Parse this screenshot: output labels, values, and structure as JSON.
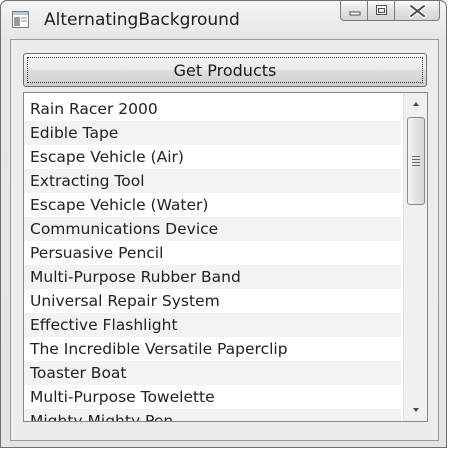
{
  "window": {
    "title": "AlternatingBackground",
    "icon": "window-app-icon",
    "caption_buttons": [
      "minimize-icon",
      "maximize-icon",
      "close-icon"
    ]
  },
  "toolbar": {
    "get_products_label": "Get Products"
  },
  "products": [
    "Rain Racer 2000",
    "Edible Tape",
    "Escape Vehicle (Air)",
    "Extracting Tool",
    "Escape Vehicle (Water)",
    "Communications Device",
    "Persuasive Pencil",
    "Multi-Purpose Rubber Band",
    "Universal Repair System",
    "Effective Flashlight",
    "The Incredible Versatile Paperclip",
    "Toaster Boat",
    "Multi-Purpose Towelette",
    "Mighty Mighty Pen"
  ],
  "colors": {
    "row_alternate": "#f3f3f3",
    "row_normal": "#ffffff"
  }
}
